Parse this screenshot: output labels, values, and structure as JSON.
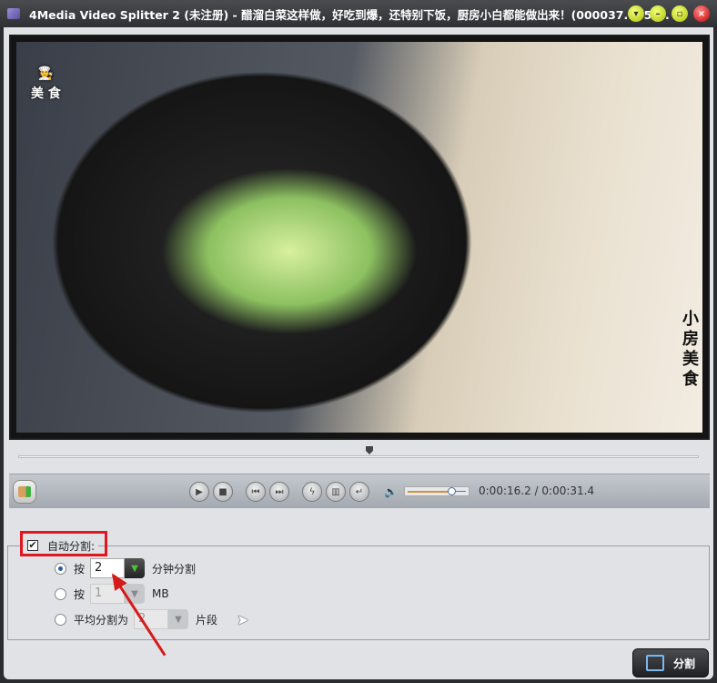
{
  "window": {
    "title": "4Media Video Splitter 2 (未注册) - 醋溜白菜这样做，好吃到爆，还特别下饭，厨房小白都能做出来！(000037.785-..."
  },
  "video": {
    "logo_text": "小房\n美 食",
    "side_text": "小房美食"
  },
  "player": {
    "current_time": "0:00:16.2",
    "separator": " / ",
    "total_time": "0:00:31.4",
    "seek_fraction": 0.516,
    "volume_fraction": 0.75
  },
  "auto_split": {
    "label": "自动分割:",
    "checked": true,
    "options": [
      {
        "prefix": "按",
        "value": "2",
        "suffix": "分钟分割",
        "selected": true
      },
      {
        "prefix": "按",
        "value": "1",
        "suffix": "MB",
        "selected": false
      },
      {
        "prefix": "平均分割为",
        "value": "2",
        "suffix": "片段",
        "selected": false
      }
    ]
  },
  "split_button": {
    "label": "分割"
  }
}
